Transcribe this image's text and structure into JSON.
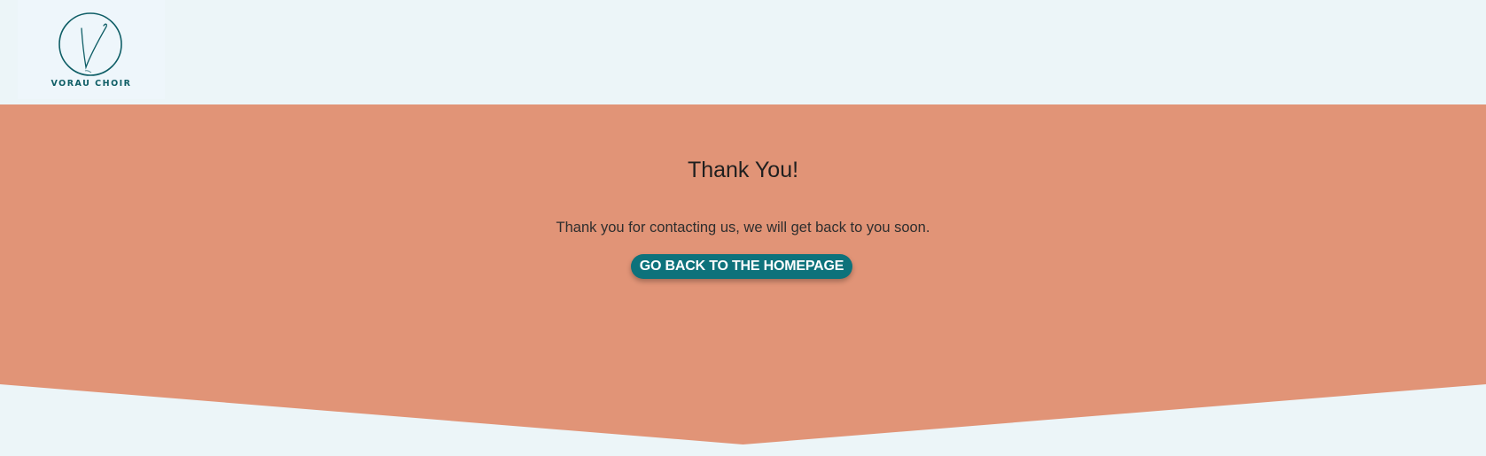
{
  "header": {
    "logo": {
      "icon": "v-monogram-circle-icon",
      "text": "VORAU CHOIR",
      "color": "#0f5e66"
    }
  },
  "hero": {
    "background_color": "#e19477",
    "title": "Thank You!",
    "message": "Thank you for contacting us, we will get back to you soon.",
    "button_label": "GO BACK TO THE HOMEPAGE",
    "button_color": "#0d727b"
  },
  "page": {
    "background_color": "#ecf5f8"
  }
}
